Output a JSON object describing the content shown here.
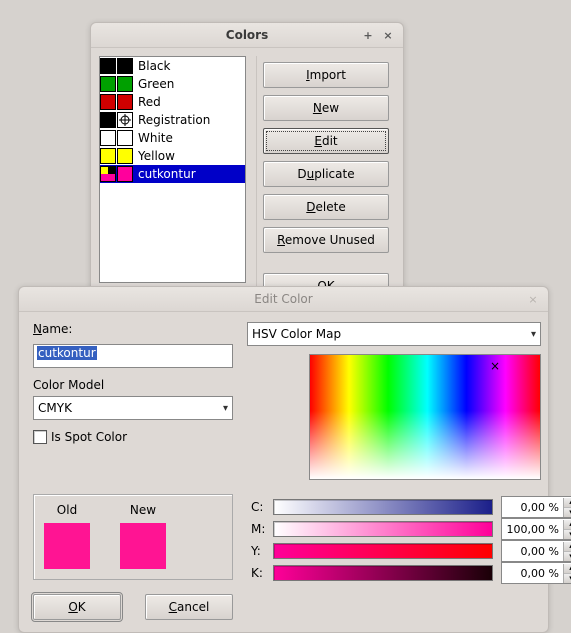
{
  "colors_window": {
    "title": "Colors",
    "items": [
      {
        "name": "Black",
        "c1": "#000000",
        "c2": "#000000",
        "c3": "#000000",
        "c4": "#000000"
      },
      {
        "name": "Green",
        "c1": "#00a000",
        "c2": "#00a000",
        "c3": "#00a000",
        "c4": "#00a000"
      },
      {
        "name": "Red",
        "c1": "#d00000",
        "c2": "#d00000",
        "c3": "#d00000",
        "c4": "#d00000"
      },
      {
        "name": "Registration",
        "reg": true
      },
      {
        "name": "White",
        "c1": "#ffffff",
        "c2": "#ffffff",
        "c3": "#ffffff",
        "c4": "#ffffff"
      },
      {
        "name": "Yellow",
        "c1": "#ffff00",
        "c2": "#ffff00",
        "c3": "#ffff00",
        "c4": "#ffff00"
      },
      {
        "name": "cutkontur",
        "c1": "#ffff00",
        "c2": "#000000",
        "c3": "#ff009c",
        "c4": "#ff009c",
        "selected": true
      }
    ],
    "buttons": {
      "import": "Import",
      "new": "New",
      "edit": "Edit",
      "duplicate": "Duplicate",
      "delete": "Delete",
      "remove_unused": "Remove Unused",
      "ok": "OK"
    }
  },
  "edit_window": {
    "title": "Edit Color",
    "name_label": "Name:",
    "name_value": "cutkontur",
    "color_model_label": "Color Model",
    "color_model_value": "CMYK",
    "is_spot_label": "Is Spot Color",
    "map_label": "HSV Color Map",
    "old_label": "Old",
    "new_label": "New",
    "old_color": "#ff1493",
    "new_color": "#ff1493",
    "channels": {
      "c": {
        "label": "C:",
        "value": "0,00 %",
        "grad": "linear-gradient(to right,#ffffff,#1b1f8a)"
      },
      "m": {
        "label": "M:",
        "value": "100,00 %",
        "grad": "linear-gradient(to right,#ffffff,#ff0099)"
      },
      "y": {
        "label": "Y:",
        "value": "0,00 %",
        "grad": "linear-gradient(to right,#ff0099,#ff0000)"
      },
      "k": {
        "label": "K:",
        "value": "0,00 %",
        "grad": "linear-gradient(to right,#ff0099,#1a0007)"
      }
    },
    "ok": "OK",
    "cancel": "Cancel"
  }
}
